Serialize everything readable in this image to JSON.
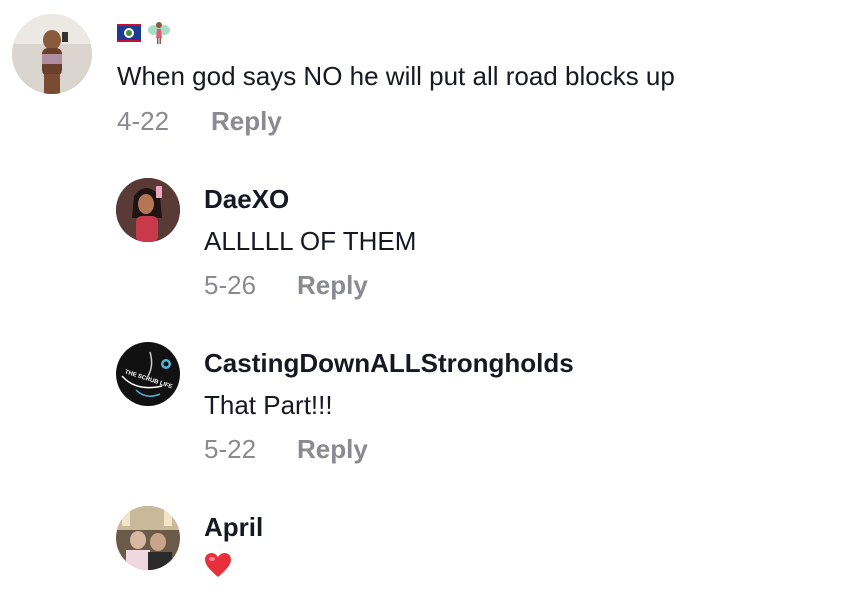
{
  "comments": [
    {
      "username": "",
      "username_icons": [
        "belize-flag-icon",
        "fairy-icon"
      ],
      "text": "When god says NO he will put all road blocks up",
      "date": "4-22",
      "reply_label": "Reply"
    },
    {
      "username": "DaeXO",
      "text": "ALLLLL OF THEM",
      "date": "5-26",
      "reply_label": "Reply"
    },
    {
      "username": "CastingDownALLStrongholds",
      "avatar_text": "THE SCRUB LIFE",
      "text": "That Part!!!",
      "date": "5-22",
      "reply_label": "Reply"
    },
    {
      "username": "April",
      "text_icon": "red-heart-icon"
    }
  ],
  "colors": {
    "text": "#161823",
    "meta": "#8a8b91",
    "heart": "#e8303c",
    "background": "#ffffff"
  }
}
